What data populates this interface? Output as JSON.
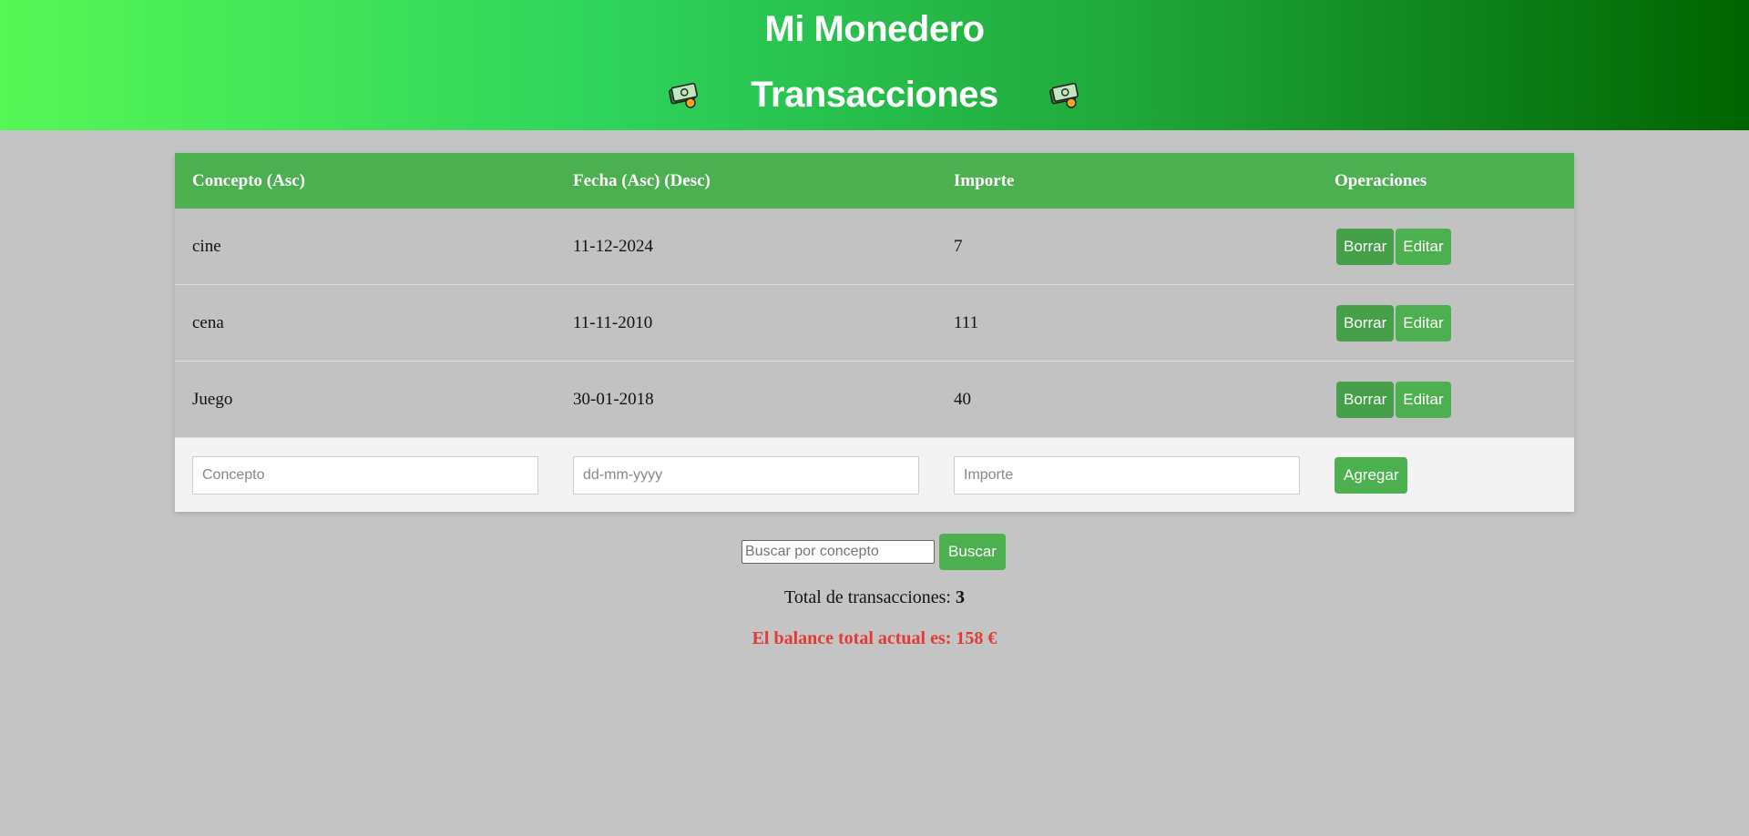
{
  "header": {
    "app_title": "Mi Monedero",
    "subtitle": "Transacciones",
    "icons": [
      "money-icon",
      "money-icon"
    ],
    "gradient": [
      "#55f755",
      "#006400"
    ]
  },
  "table": {
    "headers": {
      "concepto": "Concepto (Asc)",
      "fecha": "Fecha (Asc) (Desc)",
      "importe": "Importe",
      "operaciones": "Operaciones"
    },
    "rows": [
      {
        "concepto": "cine",
        "fecha": "11-12-2024",
        "importe": "7"
      },
      {
        "concepto": "cena",
        "fecha": "11-11-2010",
        "importe": "111"
      },
      {
        "concepto": "Juego",
        "fecha": "30-01-2018",
        "importe": "40"
      }
    ],
    "row_actions": {
      "delete_label": "Borrar",
      "edit_label": "Editar"
    },
    "add_row": {
      "concepto_placeholder": "Concepto",
      "fecha_placeholder": "dd-mm-yyyy",
      "importe_placeholder": "Importe",
      "add_label": "Agregar"
    }
  },
  "search": {
    "placeholder": "Buscar por concepto",
    "button_label": "Buscar"
  },
  "summary": {
    "total_label": "Total de transacciones: ",
    "total_value": "3",
    "balance_text": "El balance total actual es: 158 €"
  },
  "colors": {
    "accent": "#4caf50",
    "background": "#c4c4c4",
    "balance": "#e53935"
  }
}
